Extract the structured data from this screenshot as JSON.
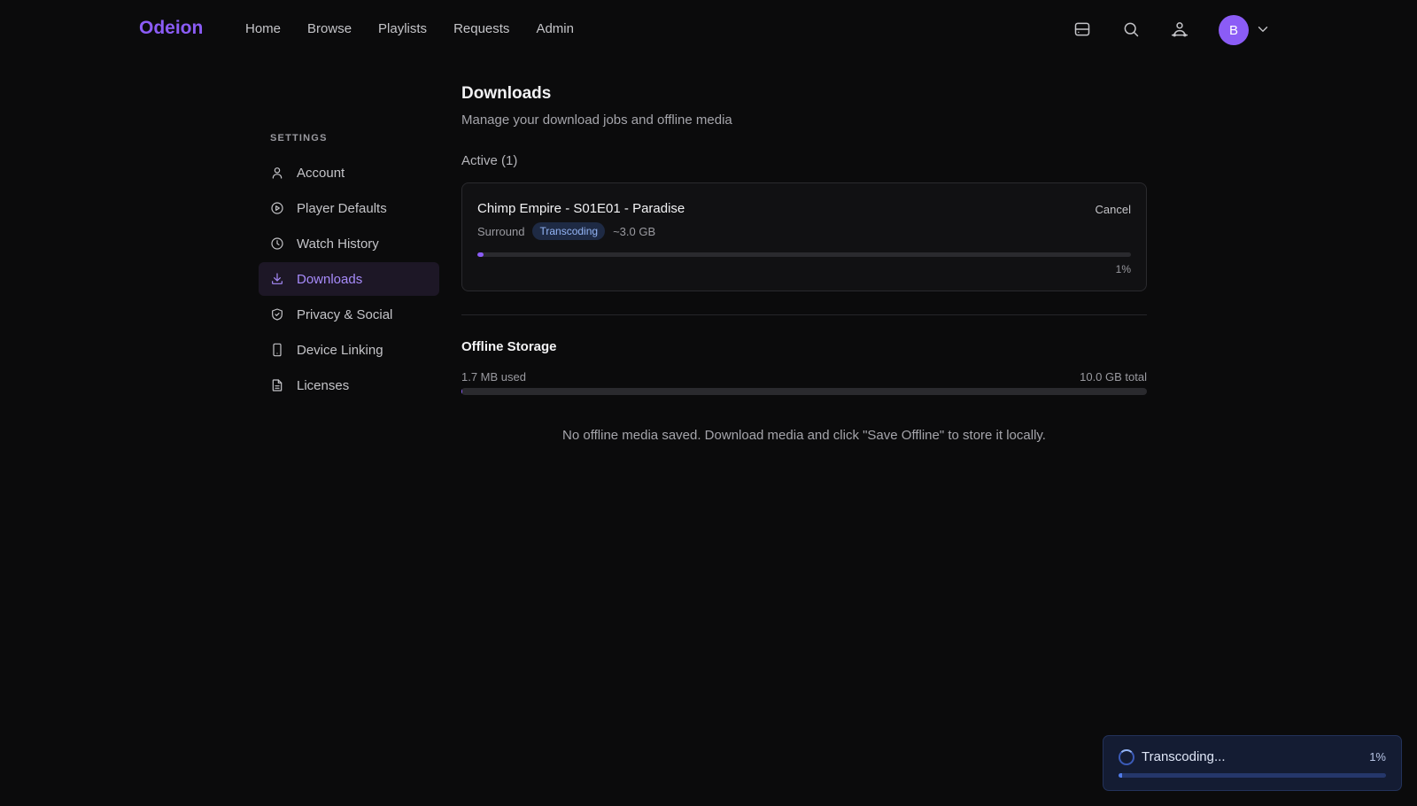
{
  "nav": {
    "logo": "Odeion",
    "links": [
      "Home",
      "Browse",
      "Playlists",
      "Requests",
      "Admin"
    ],
    "icons": [
      "server-icon",
      "search-icon",
      "users-icon"
    ],
    "avatar_initial": "B"
  },
  "sidebar": {
    "heading": "SETTINGS",
    "items": [
      {
        "label": "Account",
        "icon": "user-icon"
      },
      {
        "label": "Player Defaults",
        "icon": "play-circle-icon"
      },
      {
        "label": "Watch History",
        "icon": "clock-icon"
      },
      {
        "label": "Downloads",
        "icon": "download-icon",
        "active": true
      },
      {
        "label": "Privacy & Social",
        "icon": "shield-icon"
      },
      {
        "label": "Device Linking",
        "icon": "smartphone-icon"
      },
      {
        "label": "Licenses",
        "icon": "document-icon"
      }
    ]
  },
  "main": {
    "title": "Downloads",
    "subtitle": "Manage your download jobs and offline media",
    "active_label": "Active (1)",
    "job": {
      "title": "Chimp Empire - S01E01 - Paradise",
      "audio": "Surround",
      "status": "Transcoding",
      "size": "~3.0 GB",
      "cancel_label": "Cancel",
      "progress": 0.01,
      "progress_text": "1%"
    },
    "storage": {
      "title": "Offline Storage",
      "used": "1.7 MB used",
      "total": "10.0 GB total",
      "fraction": 0.0002
    },
    "empty_message": "No offline media saved. Download media and click \"Save Offline\" to store it locally."
  },
  "toast": {
    "label": "Transcoding...",
    "progress_text": "1%",
    "progress": 0.01
  },
  "colors": {
    "accent": "#8b5cf6",
    "background": "#0b0b0c",
    "toast_bg": "#141c33"
  }
}
